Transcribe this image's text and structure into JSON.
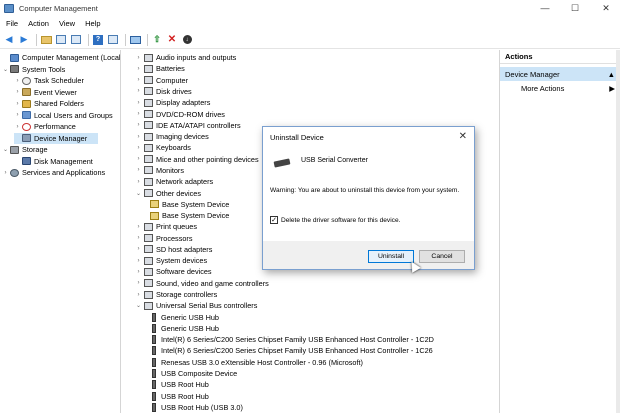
{
  "window": {
    "title": "Computer Management",
    "min": "—",
    "max": "☐",
    "close": "✕"
  },
  "menu": [
    "File",
    "Action",
    "View",
    "Help"
  ],
  "tree": [
    {
      "label": "Computer Management (Local",
      "chev": "",
      "icon": "comp"
    },
    {
      "label": "System Tools",
      "chev": "⌄",
      "icon": "tools"
    },
    {
      "label": "Task Scheduler",
      "chev": "›",
      "icon": "clock"
    },
    {
      "label": "Event Viewer",
      "chev": "›",
      "icon": "log"
    },
    {
      "label": "Shared Folders",
      "chev": "›",
      "icon": "share"
    },
    {
      "label": "Local Users and Groups",
      "chev": "›",
      "icon": "users"
    },
    {
      "label": "Performance",
      "chev": "›",
      "icon": "perf"
    },
    {
      "label": "Device Manager",
      "chev": "",
      "icon": "dev"
    },
    {
      "label": "Storage",
      "chev": "⌄",
      "icon": "storage"
    },
    {
      "label": "Disk Management",
      "chev": "",
      "icon": "disk"
    },
    {
      "label": "Services and Applications",
      "chev": "›",
      "icon": "svc"
    }
  ],
  "devices": [
    {
      "label": "Audio inputs and outputs",
      "chev": "›"
    },
    {
      "label": "Batteries",
      "chev": "›"
    },
    {
      "label": "Computer",
      "chev": "›"
    },
    {
      "label": "Disk drives",
      "chev": "›"
    },
    {
      "label": "Display adapters",
      "chev": "›"
    },
    {
      "label": "DVD/CD-ROM drives",
      "chev": "›"
    },
    {
      "label": "IDE ATA/ATAPI controllers",
      "chev": "›"
    },
    {
      "label": "Imaging devices",
      "chev": "›"
    },
    {
      "label": "Keyboards",
      "chev": "›"
    },
    {
      "label": "Mice and other pointing devices",
      "chev": "›"
    },
    {
      "label": "Monitors",
      "chev": "›"
    },
    {
      "label": "Network adapters",
      "chev": "›"
    },
    {
      "label": "Other devices",
      "chev": "⌄"
    },
    {
      "label": "Base System Device",
      "chev": "",
      "child": true,
      "warn": true
    },
    {
      "label": "Base System Device",
      "chev": "",
      "child": true,
      "warn": true
    },
    {
      "label": "Print queues",
      "chev": "›"
    },
    {
      "label": "Processors",
      "chev": "›"
    },
    {
      "label": "SD host adapters",
      "chev": "›"
    },
    {
      "label": "System devices",
      "chev": "›"
    },
    {
      "label": "Software devices",
      "chev": "›"
    },
    {
      "label": "Sound, video and game controllers",
      "chev": "›"
    },
    {
      "label": "Storage controllers",
      "chev": "›"
    },
    {
      "label": "Universal Serial Bus controllers",
      "chev": "⌄"
    },
    {
      "label": "Generic USB Hub",
      "chev": "",
      "child": true,
      "usb": true
    },
    {
      "label": "Generic USB Hub",
      "chev": "",
      "child": true,
      "usb": true
    },
    {
      "label": "Intel(R) 6 Series/C200 Series Chipset Family USB Enhanced Host Controller - 1C2D",
      "chev": "",
      "child": true,
      "usb": true
    },
    {
      "label": "Intel(R) 6 Series/C200 Series Chipset Family USB Enhanced Host Controller - 1C26",
      "chev": "",
      "child": true,
      "usb": true
    },
    {
      "label": "Renesas USB 3.0 eXtensible Host Controller - 0.96 (Microsoft)",
      "chev": "",
      "child": true,
      "usb": true
    },
    {
      "label": "USB Composite Device",
      "chev": "",
      "child": true,
      "usb": true
    },
    {
      "label": "USB Root Hub",
      "chev": "",
      "child": true,
      "usb": true
    },
    {
      "label": "USB Root Hub",
      "chev": "",
      "child": true,
      "usb": true
    },
    {
      "label": "USB Root Hub (USB 3.0)",
      "chev": "",
      "child": true,
      "usb": true
    }
  ],
  "actions": {
    "header": "Actions",
    "section": "Device Manager",
    "section_arrow": "▲",
    "item": "More Actions",
    "item_arrow": "▶"
  },
  "dialog": {
    "title": "Uninstall Device",
    "close": "✕",
    "device": "USB Serial Converter",
    "warning": "Warning: You are about to uninstall this device from your system.",
    "checkbox_label": "Delete the driver software for this device.",
    "checked": "✓",
    "uninstall": "Uninstall",
    "cancel": "Cancel"
  }
}
